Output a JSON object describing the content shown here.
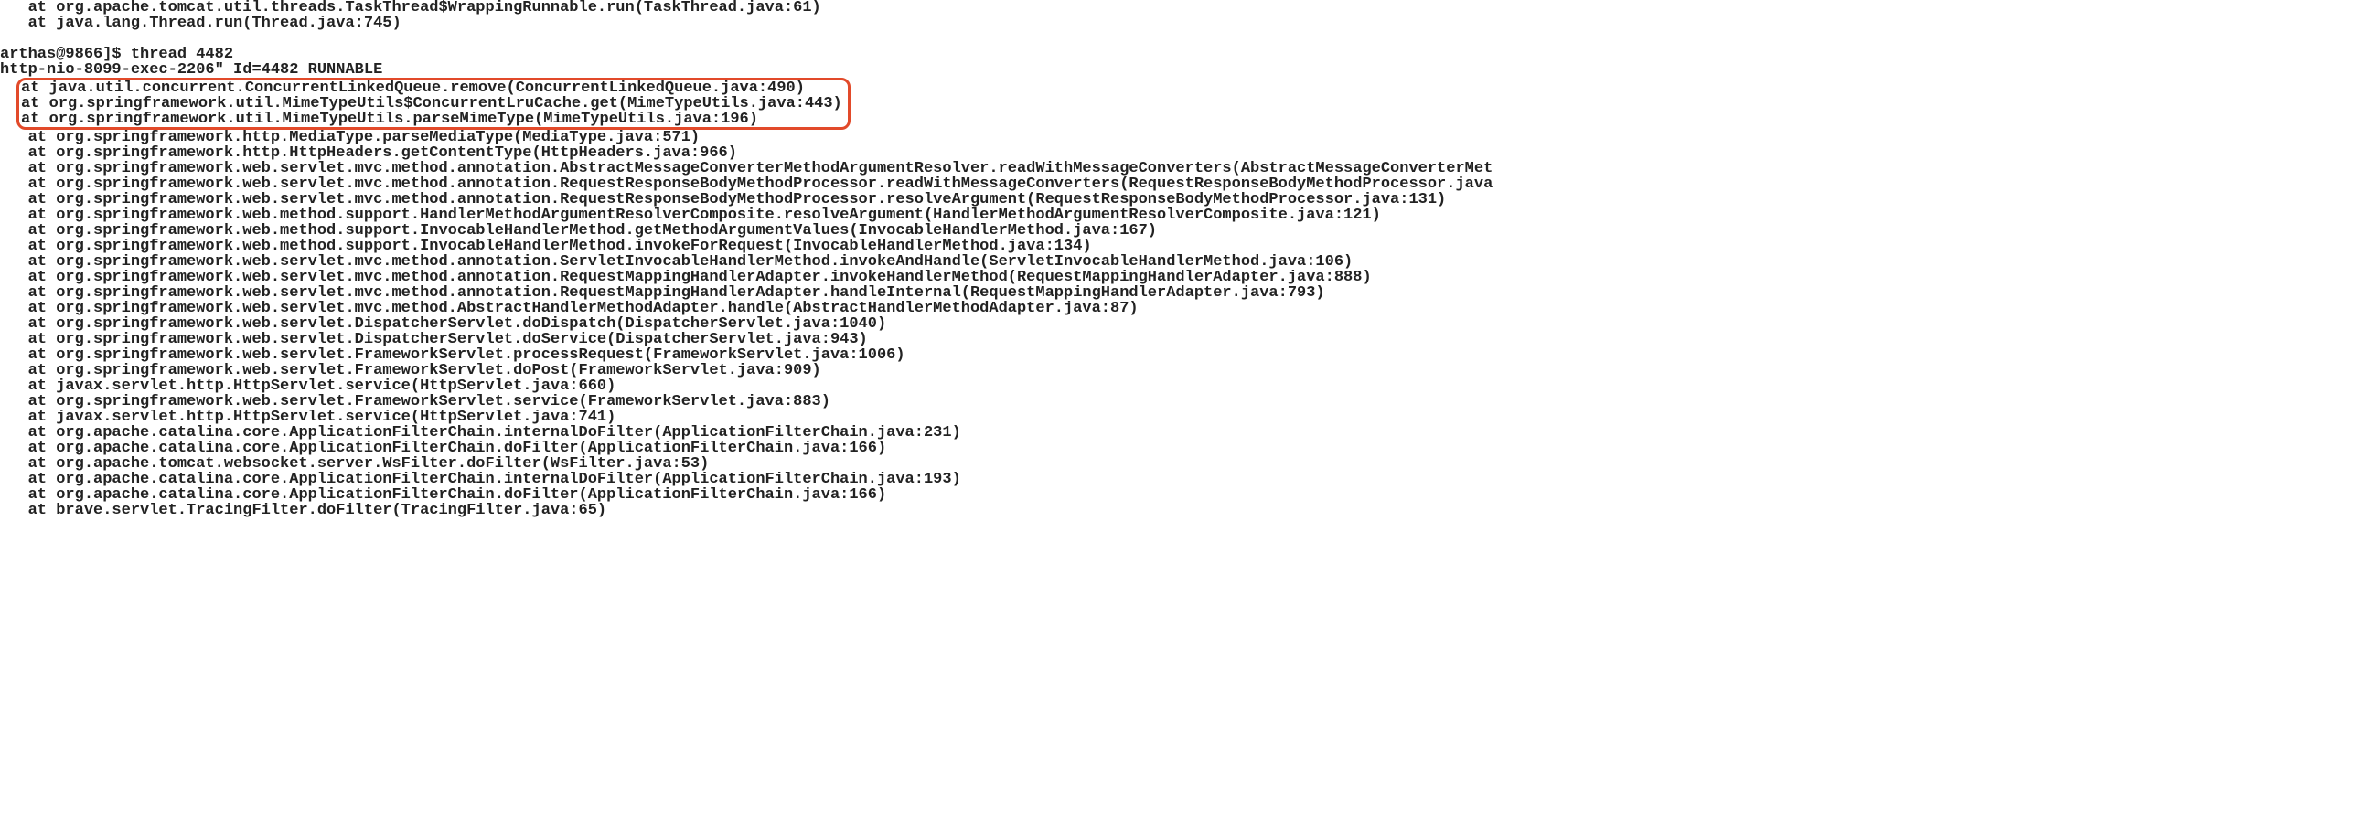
{
  "header_lines": [
    "   at org.apache.tomcat.util.threads.TaskThread$WrappingRunnable.run(TaskThread.java:61)",
    "   at java.lang.Thread.run(Thread.java:745)"
  ],
  "prompt_line": "arthas@9866]$ thread 4482",
  "thread_title": "http-nio-8099-exec-2206\" Id=4482 RUNNABLE",
  "highlighted": [
    "at java.util.concurrent.ConcurrentLinkedQueue.remove(ConcurrentLinkedQueue.java:490)",
    "at org.springframework.util.MimeTypeUtils$ConcurrentLruCache.get(MimeTypeUtils.java:443)",
    "at org.springframework.util.MimeTypeUtils.parseMimeType(MimeTypeUtils.java:196)"
  ],
  "stack": [
    "   at org.springframework.http.MediaType.parseMediaType(MediaType.java:571)",
    "   at org.springframework.http.HttpHeaders.getContentType(HttpHeaders.java:966)",
    "   at org.springframework.web.servlet.mvc.method.annotation.AbstractMessageConverterMethodArgumentResolver.readWithMessageConverters(AbstractMessageConverterMet",
    "   at org.springframework.web.servlet.mvc.method.annotation.RequestResponseBodyMethodProcessor.readWithMessageConverters(RequestResponseBodyMethodProcessor.java",
    "   at org.springframework.web.servlet.mvc.method.annotation.RequestResponseBodyMethodProcessor.resolveArgument(RequestResponseBodyMethodProcessor.java:131)",
    "   at org.springframework.web.method.support.HandlerMethodArgumentResolverComposite.resolveArgument(HandlerMethodArgumentResolverComposite.java:121)",
    "   at org.springframework.web.method.support.InvocableHandlerMethod.getMethodArgumentValues(InvocableHandlerMethod.java:167)",
    "   at org.springframework.web.method.support.InvocableHandlerMethod.invokeForRequest(InvocableHandlerMethod.java:134)",
    "   at org.springframework.web.servlet.mvc.method.annotation.ServletInvocableHandlerMethod.invokeAndHandle(ServletInvocableHandlerMethod.java:106)",
    "   at org.springframework.web.servlet.mvc.method.annotation.RequestMappingHandlerAdapter.invokeHandlerMethod(RequestMappingHandlerAdapter.java:888)",
    "   at org.springframework.web.servlet.mvc.method.annotation.RequestMappingHandlerAdapter.handleInternal(RequestMappingHandlerAdapter.java:793)",
    "   at org.springframework.web.servlet.mvc.method.AbstractHandlerMethodAdapter.handle(AbstractHandlerMethodAdapter.java:87)",
    "   at org.springframework.web.servlet.DispatcherServlet.doDispatch(DispatcherServlet.java:1040)",
    "   at org.springframework.web.servlet.DispatcherServlet.doService(DispatcherServlet.java:943)",
    "   at org.springframework.web.servlet.FrameworkServlet.processRequest(FrameworkServlet.java:1006)",
    "   at org.springframework.web.servlet.FrameworkServlet.doPost(FrameworkServlet.java:909)",
    "   at javax.servlet.http.HttpServlet.service(HttpServlet.java:660)",
    "   at org.springframework.web.servlet.FrameworkServlet.service(FrameworkServlet.java:883)",
    "   at javax.servlet.http.HttpServlet.service(HttpServlet.java:741)",
    "   at org.apache.catalina.core.ApplicationFilterChain.internalDoFilter(ApplicationFilterChain.java:231)",
    "   at org.apache.catalina.core.ApplicationFilterChain.doFilter(ApplicationFilterChain.java:166)",
    "   at org.apache.tomcat.websocket.server.WsFilter.doFilter(WsFilter.java:53)",
    "   at org.apache.catalina.core.ApplicationFilterChain.internalDoFilter(ApplicationFilterChain.java:193)",
    "   at org.apache.catalina.core.ApplicationFilterChain.doFilter(ApplicationFilterChain.java:166)",
    "   at brave.servlet.TracingFilter.doFilter(TracingFilter.java:65)"
  ],
  "watermark": ""
}
